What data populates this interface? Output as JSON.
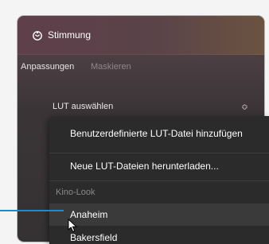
{
  "panel": {
    "title": "Stimmung",
    "icon": "mood-icon"
  },
  "tabs": [
    {
      "label": "Anpassungen",
      "active": true
    },
    {
      "label": "Maskieren",
      "active": false
    }
  ],
  "lut_select": {
    "label": "LUT auswählen",
    "chevron_icon": "up-down-chevron-icon"
  },
  "dropdown": {
    "items": [
      {
        "label": "Benutzerdefinierte LUT-Datei hinzufügen"
      },
      {
        "label": "Neue LUT-Dateien herunterladen..."
      }
    ],
    "section_header": "Kino-Look",
    "lut_items": [
      {
        "label": "Anaheim",
        "hovered": true
      },
      {
        "label": "Bakersfield",
        "hovered": false
      }
    ]
  },
  "colors": {
    "pointer_line": "#1a8bd6",
    "dropdown_bg": "#2b2b2b"
  }
}
